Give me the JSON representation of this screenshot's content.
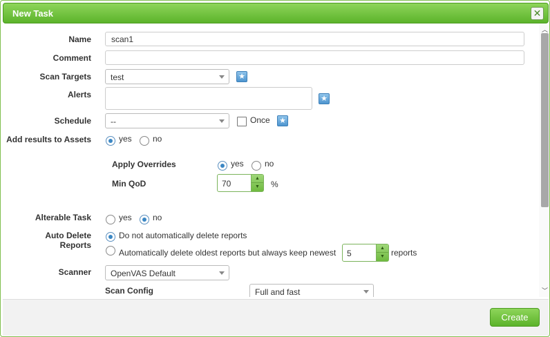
{
  "dialog": {
    "title": "New Task",
    "close_glyph": "✕",
    "create_label": "Create"
  },
  "form": {
    "name": {
      "label": "Name",
      "value": "scan1"
    },
    "comment": {
      "label": "Comment",
      "value": ""
    },
    "scan_targets": {
      "label": "Scan Targets",
      "selected": "test"
    },
    "alerts": {
      "label": "Alerts"
    },
    "schedule": {
      "label": "Schedule",
      "selected": "--",
      "once_label": "Once",
      "once_checked": false
    },
    "add_results": {
      "label": "Add results to Assets",
      "yes_label": "yes",
      "no_label": "no",
      "selected": "yes"
    },
    "apply_overrides": {
      "label": "Apply Overrides",
      "yes_label": "yes",
      "no_label": "no",
      "selected": "yes"
    },
    "min_qod": {
      "label": "Min QoD",
      "value": "70",
      "unit": "%"
    },
    "alterable_task": {
      "label": "Alterable Task",
      "yes_label": "yes",
      "no_label": "no",
      "selected": "no"
    },
    "auto_delete": {
      "label": "Auto Delete Reports",
      "option_keep": "Do not automatically delete reports",
      "option_delete": "Automatically delete oldest reports but always keep newest",
      "keep_count": "5",
      "reports_suffix": "reports",
      "selected": "keep"
    },
    "scanner": {
      "label": "Scanner",
      "selected": "OpenVAS Default"
    },
    "scan_config": {
      "label": "Scan Config",
      "selected": "Full and fast"
    }
  },
  "icons": {
    "new_target": "star-icon",
    "new_alert": "star-icon",
    "new_schedule": "star-icon",
    "close": "close-icon"
  },
  "colors": {
    "accent_green": "#5cb32b",
    "radio_blue": "#3b87c4"
  }
}
